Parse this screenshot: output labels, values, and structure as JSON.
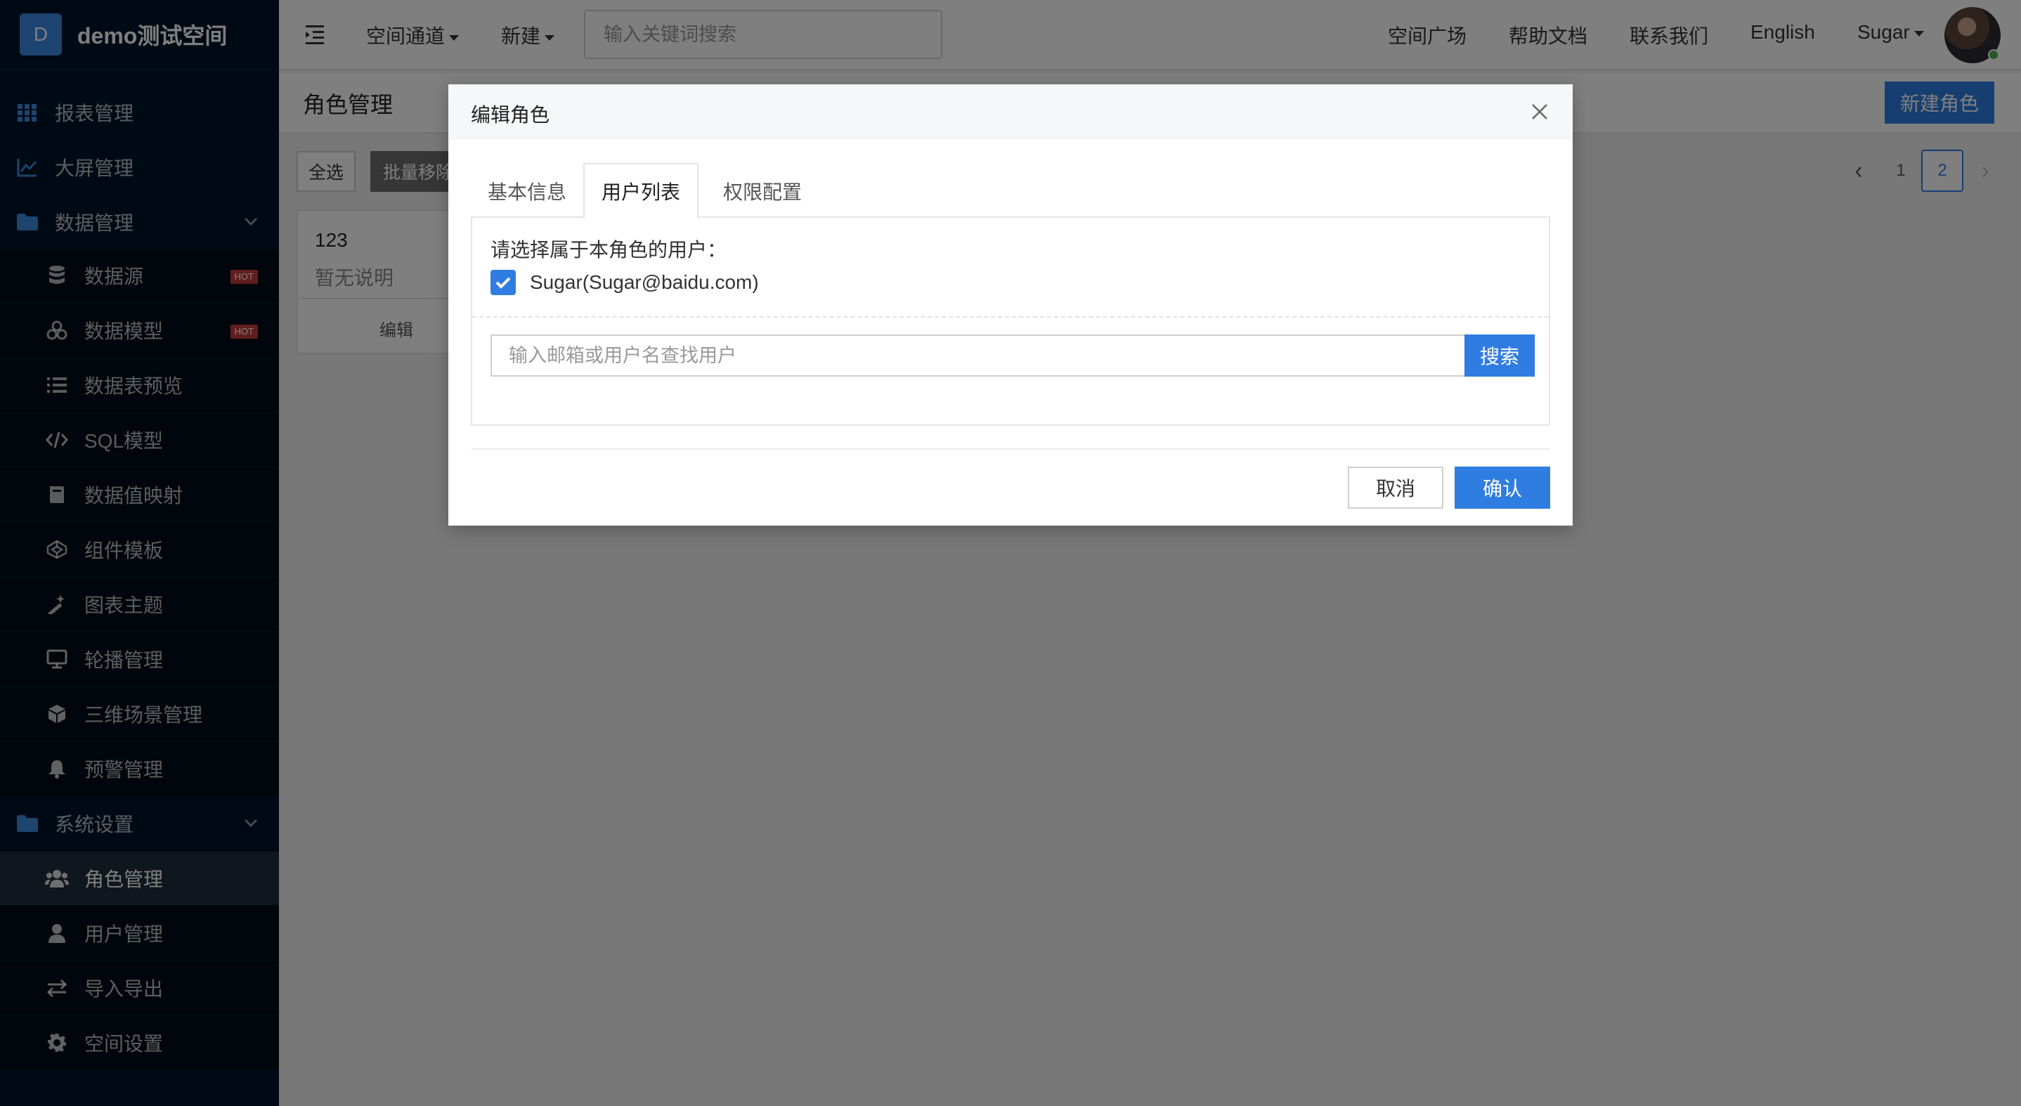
{
  "brand": {
    "logo_letter": "D",
    "name": "demo测试空间",
    "accent": "#3b86e0"
  },
  "sidebar": {
    "items": [
      {
        "label": "报表管理",
        "icon": "grid-icon"
      },
      {
        "label": "大屏管理",
        "icon": "line-chart-icon"
      },
      {
        "label": "数据管理",
        "icon": "folder-icon",
        "expanded": true
      },
      {
        "label": "数据源",
        "icon": "database-icon",
        "badge": "HOT"
      },
      {
        "label": "数据模型",
        "icon": "model-icon",
        "badge": "HOT"
      },
      {
        "label": "数据表预览",
        "icon": "list-icon"
      },
      {
        "label": "SQL模型",
        "icon": "code-icon"
      },
      {
        "label": "数据值映射",
        "icon": "book-icon"
      },
      {
        "label": "组件模板",
        "icon": "codepen-icon"
      },
      {
        "label": "图表主题",
        "icon": "magic-wand-icon"
      },
      {
        "label": "轮播管理",
        "icon": "monitor-icon"
      },
      {
        "label": "三维场景管理",
        "icon": "cube-icon"
      },
      {
        "label": "预警管理",
        "icon": "bell-icon"
      },
      {
        "label": "系统设置",
        "icon": "folder-icon",
        "expanded": true
      },
      {
        "label": "角色管理",
        "icon": "users-icon",
        "active": true
      },
      {
        "label": "用户管理",
        "icon": "user-icon"
      },
      {
        "label": "导入导出",
        "icon": "exchange-icon"
      },
      {
        "label": "空间设置",
        "icon": "gear-icon"
      }
    ]
  },
  "header": {
    "space_channel": "空间通道",
    "new": "新建",
    "search_placeholder": "输入关键词搜索",
    "links": {
      "plaza": "空间广场",
      "docs": "帮助文档",
      "contact": "联系我们",
      "lang": "English"
    },
    "user": "Sugar"
  },
  "page": {
    "title": "角色管理",
    "new_role": "新建角色",
    "select_all": "全选",
    "batch_remove": "批量移除",
    "pagination": {
      "prev": "‹",
      "pages": [
        "1",
        "2"
      ],
      "current": "2",
      "next": "›"
    },
    "role_card": {
      "name": "123",
      "desc": "暂无说明",
      "edit": "编辑"
    }
  },
  "modal": {
    "title": "编辑角色",
    "tabs": [
      "基本信息",
      "用户列表",
      "权限配置"
    ],
    "active_tab": "用户列表",
    "prompt": "请选择属于本角色的用户：",
    "users": [
      {
        "label": "Sugar(Sugar@baidu.com)",
        "checked": true
      }
    ],
    "search_placeholder": "输入邮箱或用户名查找用户",
    "search_button": "搜索",
    "cancel": "取消",
    "confirm": "确认"
  },
  "colors": {
    "primary": "#2f7de1",
    "sidebar_bg": "#001529",
    "hot_badge": "#c43c3c"
  }
}
